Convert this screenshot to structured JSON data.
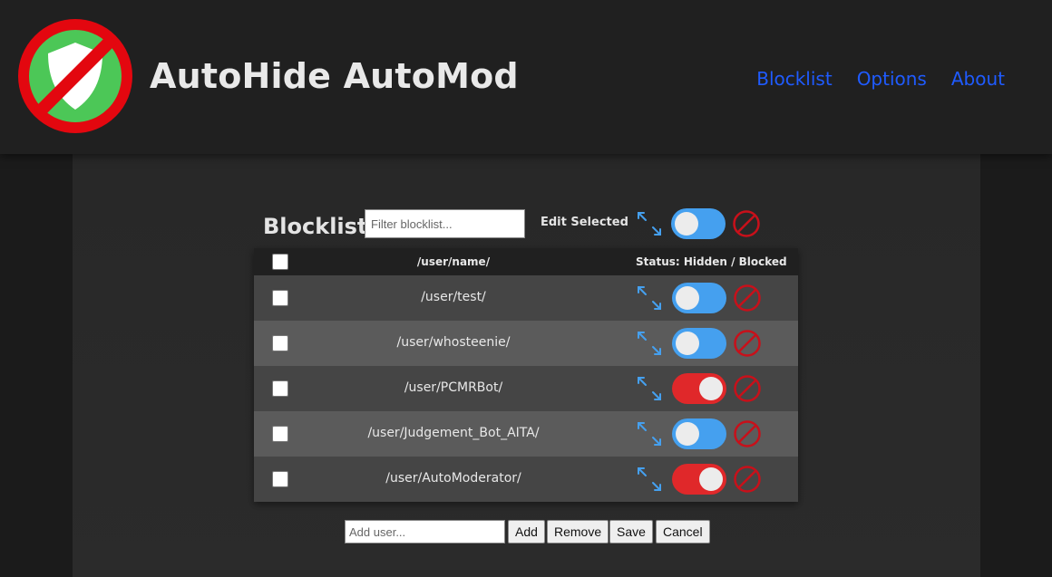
{
  "header": {
    "title": "AutoHide AutoMod",
    "logo_icon": "shield-prohibited-icon",
    "nav": [
      "Blocklist",
      "Options",
      "About"
    ]
  },
  "toolbar": {
    "title": "Blocklist",
    "filter_placeholder": "Filter blocklist...",
    "edit_selected_label": "Edit Selected",
    "toggle_state": "off"
  },
  "table": {
    "columns": {
      "name": "/user/name/",
      "status": "Status: Hidden / Blocked"
    },
    "rows": [
      {
        "name": "/user/test/",
        "state": "off"
      },
      {
        "name": "/user/whosteenie/",
        "state": "off"
      },
      {
        "name": "/user/PCMRBot/",
        "state": "on"
      },
      {
        "name": "/user/Judgement_Bot_AITA/",
        "state": "off"
      },
      {
        "name": "/user/AutoModerator/",
        "state": "on"
      }
    ]
  },
  "footer": {
    "add_placeholder": "Add user...",
    "buttons": [
      "Add",
      "Remove",
      "Save",
      "Cancel"
    ]
  },
  "colors": {
    "nav_link": "#1f5bff",
    "toggle_off": "#45a0ef",
    "toggle_on": "#e0282a",
    "block_icon": "#c8101a",
    "expand_icon": "#45a0ef"
  }
}
